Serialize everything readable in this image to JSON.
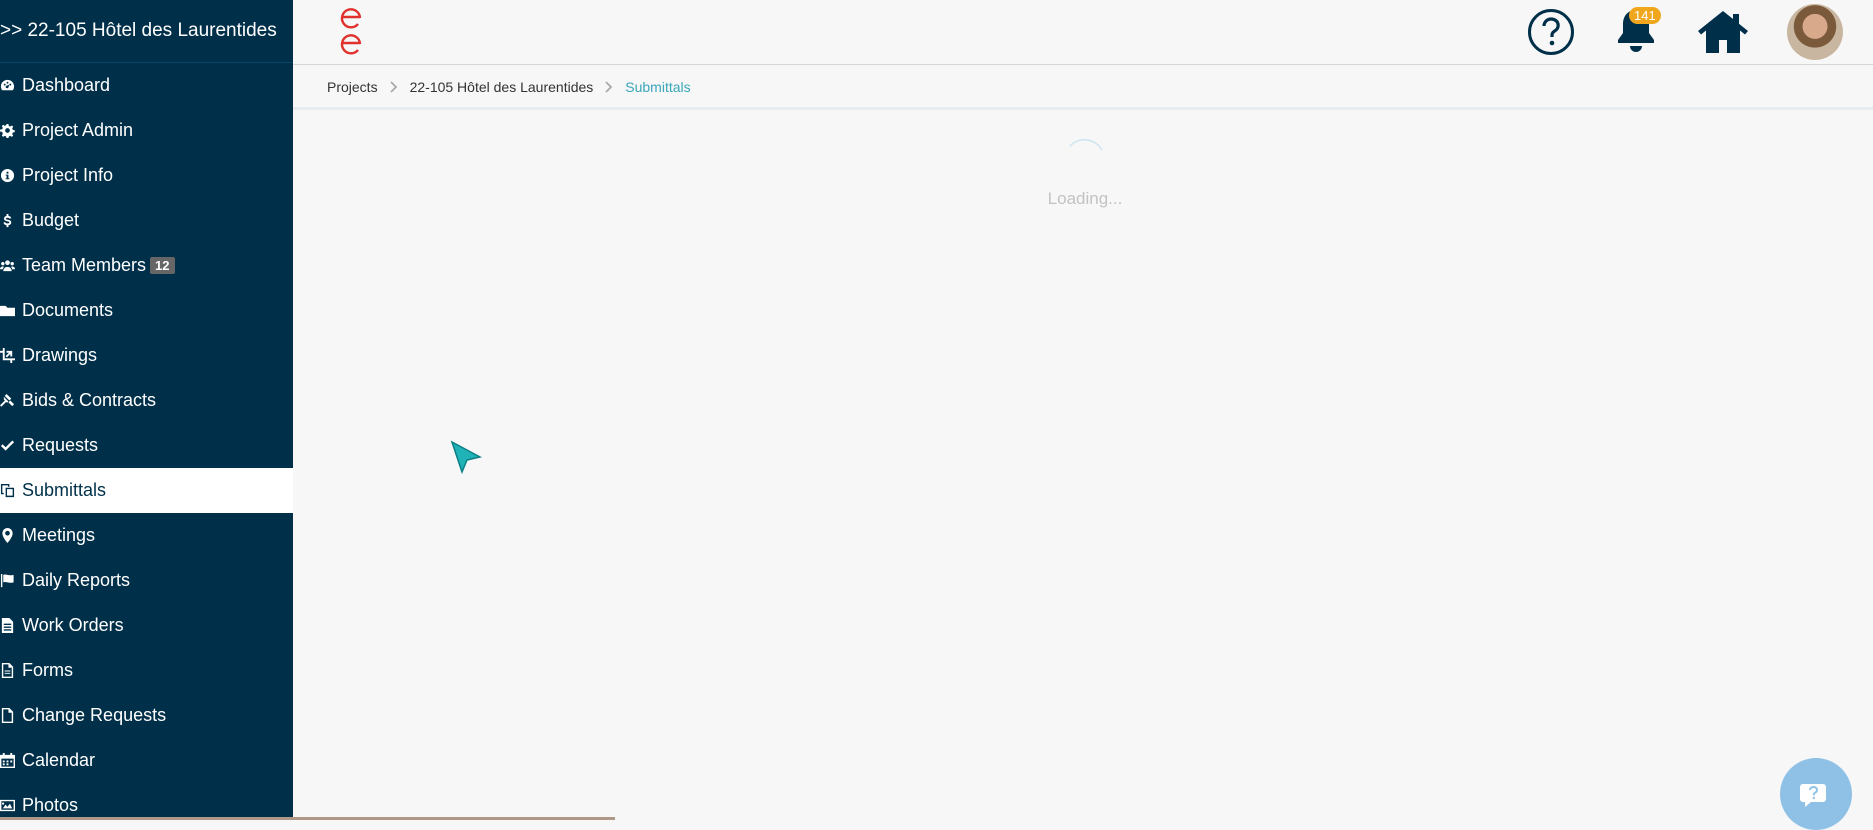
{
  "sidebar": {
    "project_title": ">> 22-105 Hôtel des Laurentides",
    "items": [
      {
        "label": "Dashboard",
        "icon": "dashboard-icon"
      },
      {
        "label": "Project Admin",
        "icon": "gear-icon"
      },
      {
        "label": "Project Info",
        "icon": "info-icon"
      },
      {
        "label": "Budget",
        "icon": "dollar-icon"
      },
      {
        "label": "Team Members",
        "icon": "team-icon",
        "badge": "12"
      },
      {
        "label": "Documents",
        "icon": "folder-icon"
      },
      {
        "label": "Drawings",
        "icon": "crop-icon"
      },
      {
        "label": "Bids & Contracts",
        "icon": "gavel-icon"
      },
      {
        "label": "Requests",
        "icon": "check-icon"
      },
      {
        "label": "Submittals",
        "icon": "copy-icon",
        "active": true
      },
      {
        "label": "Meetings",
        "icon": "map-pin-icon"
      },
      {
        "label": "Daily Reports",
        "icon": "flag-icon"
      },
      {
        "label": "Work Orders",
        "icon": "document-icon"
      },
      {
        "label": "Forms",
        "icon": "form-icon"
      },
      {
        "label": "Change Requests",
        "icon": "file-icon"
      },
      {
        "label": "Calendar",
        "icon": "calendar-icon"
      },
      {
        "label": "Photos",
        "icon": "image-icon"
      }
    ]
  },
  "header": {
    "logo": "e-logo",
    "notification_count": "141",
    "colors": {
      "sidebar_bg": "#003049",
      "logo": "#e0312d",
      "badge": "#f0a71e",
      "accent": "#3aa6b9"
    }
  },
  "breadcrumb": {
    "items": [
      "Projects",
      "22-105 Hôtel des Laurentides"
    ],
    "current": "Submittals"
  },
  "main": {
    "loading_text": "Loading..."
  }
}
